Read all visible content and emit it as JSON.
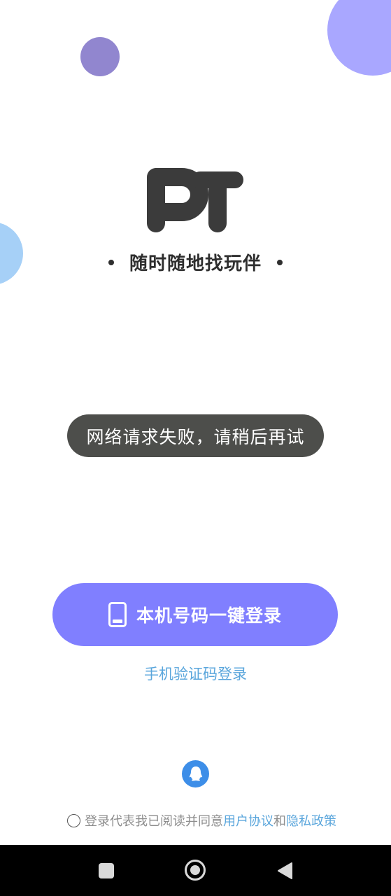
{
  "logo": {
    "text": "PT"
  },
  "tagline": "随时随地找玩伴",
  "toast": "网络请求失败，请稍后再试",
  "login": {
    "one_click_label": "本机号码一键登录",
    "sms_label": "手机验证码登录"
  },
  "agreement": {
    "prefix": "登录代表我已阅读并同意",
    "user_agreement": "用户协议",
    "and": "和",
    "privacy_policy": "隐私政策",
    "checked": false
  },
  "icons": {
    "one_click": "phone-icon",
    "qq": "qq-icon",
    "nav_recent": "square-icon",
    "nav_home": "home-circle-icon",
    "nav_back": "back-triangle-icon"
  },
  "colors": {
    "primary": "#807fff",
    "link": "#5aa6dc",
    "toast_bg": "#4d4e4b",
    "qq_blue": "#3d8ee8",
    "deco_top_right": "#a9a7ff",
    "deco_small_purple": "#9186cf",
    "deco_left_blue": "#a6d0f7"
  }
}
